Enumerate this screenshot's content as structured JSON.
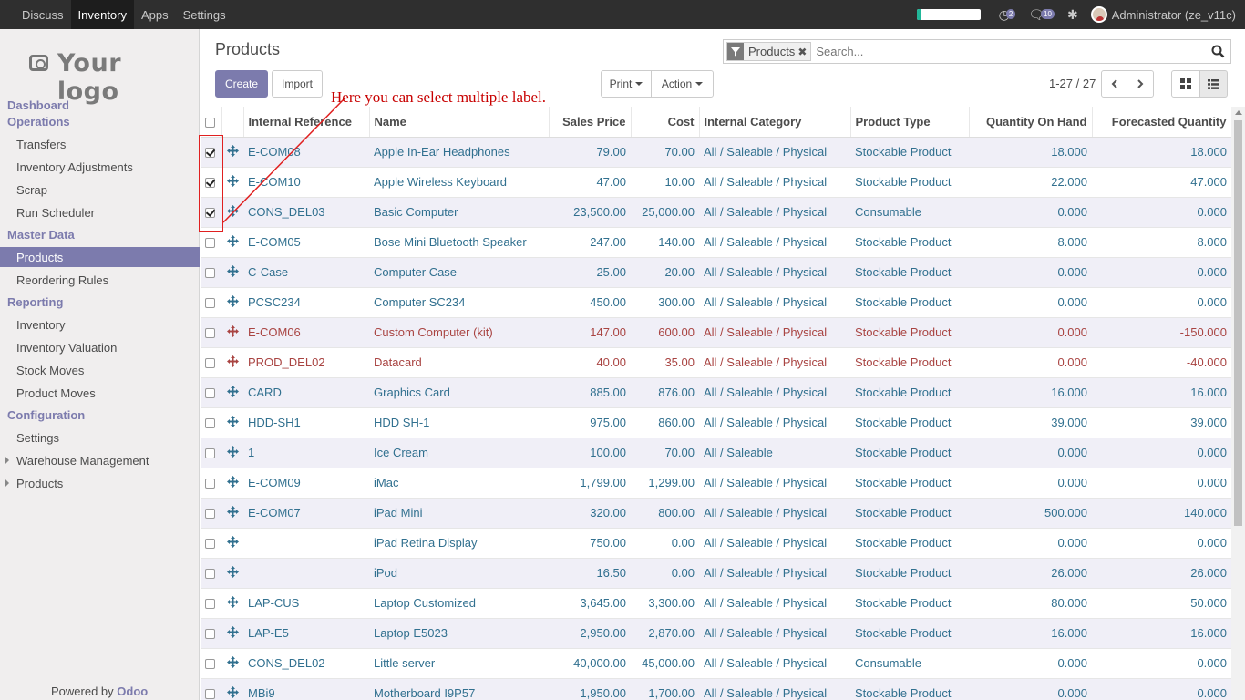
{
  "topbar": {
    "menu": [
      "Discuss",
      "Inventory",
      "Apps",
      "Settings"
    ],
    "active_index": 1,
    "badge_activity": "2",
    "badge_messages": "10",
    "user": "Administrator (ze_v11c)",
    "progress_fraction": 0.07
  },
  "sidebar": {
    "logo_text": "Your logo",
    "sections": [
      {
        "label": "Dashboard"
      },
      {
        "label": "Operations",
        "items": [
          "Transfers",
          "Inventory Adjustments",
          "Scrap",
          "Run Scheduler"
        ]
      },
      {
        "label": "Master Data",
        "items": [
          "Products",
          "Reordering Rules"
        ]
      },
      {
        "label": "Reporting",
        "items": [
          "Inventory",
          "Inventory Valuation",
          "Stock Moves",
          "Product Moves"
        ]
      },
      {
        "label": "Configuration",
        "items": [
          "Settings",
          "Warehouse Management",
          "Products"
        ]
      }
    ],
    "active_item": "Products",
    "powered_by": "Powered by",
    "powered_brand": "Odoo"
  },
  "control": {
    "title": "Products",
    "create": "Create",
    "import": "Import",
    "print": "Print",
    "action": "Action",
    "facet": "Products",
    "search_placeholder": "Search...",
    "pager": "1-27 / 27"
  },
  "annotation": "Here you can select multiple label.",
  "table": {
    "columns": [
      "Internal Reference",
      "Name",
      "Sales Price",
      "Cost",
      "Internal Category",
      "Product Type",
      "Quantity On Hand",
      "Forecasted Quantity"
    ],
    "rows": [
      {
        "checked": true,
        "danger": false,
        "ref": "E-COM08",
        "name": "Apple In-Ear Headphones",
        "price": "79.00",
        "cost": "70.00",
        "cat": "All / Saleable / Physical",
        "type": "Stockable Product",
        "qty": "18.000",
        "fq": "18.000"
      },
      {
        "checked": true,
        "danger": false,
        "ref": "E-COM10",
        "name": "Apple Wireless Keyboard",
        "price": "47.00",
        "cost": "10.00",
        "cat": "All / Saleable / Physical",
        "type": "Stockable Product",
        "qty": "22.000",
        "fq": "47.000"
      },
      {
        "checked": true,
        "danger": false,
        "ref": "CONS_DEL03",
        "name": "Basic Computer",
        "price": "23,500.00",
        "cost": "25,000.00",
        "cat": "All / Saleable / Physical",
        "type": "Consumable",
        "qty": "0.000",
        "fq": "0.000"
      },
      {
        "checked": false,
        "danger": false,
        "ref": "E-COM05",
        "name": "Bose Mini Bluetooth Speaker",
        "price": "247.00",
        "cost": "140.00",
        "cat": "All / Saleable / Physical",
        "type": "Stockable Product",
        "qty": "8.000",
        "fq": "8.000"
      },
      {
        "checked": false,
        "danger": false,
        "ref": "C-Case",
        "name": "Computer Case",
        "price": "25.00",
        "cost": "20.00",
        "cat": "All / Saleable / Physical",
        "type": "Stockable Product",
        "qty": "0.000",
        "fq": "0.000"
      },
      {
        "checked": false,
        "danger": false,
        "ref": "PCSC234",
        "name": "Computer SC234",
        "price": "450.00",
        "cost": "300.00",
        "cat": "All / Saleable / Physical",
        "type": "Stockable Product",
        "qty": "0.000",
        "fq": "0.000"
      },
      {
        "checked": false,
        "danger": true,
        "ref": "E-COM06",
        "name": "Custom Computer (kit)",
        "price": "147.00",
        "cost": "600.00",
        "cat": "All / Saleable / Physical",
        "type": "Stockable Product",
        "qty": "0.000",
        "fq": "-150.000"
      },
      {
        "checked": false,
        "danger": true,
        "ref": "PROD_DEL02",
        "name": "Datacard",
        "price": "40.00",
        "cost": "35.00",
        "cat": "All / Saleable / Physical",
        "type": "Stockable Product",
        "qty": "0.000",
        "fq": "-40.000"
      },
      {
        "checked": false,
        "danger": false,
        "ref": "CARD",
        "name": "Graphics Card",
        "price": "885.00",
        "cost": "876.00",
        "cat": "All / Saleable / Physical",
        "type": "Stockable Product",
        "qty": "16.000",
        "fq": "16.000"
      },
      {
        "checked": false,
        "danger": false,
        "ref": "HDD-SH1",
        "name": "HDD SH-1",
        "price": "975.00",
        "cost": "860.00",
        "cat": "All / Saleable / Physical",
        "type": "Stockable Product",
        "qty": "39.000",
        "fq": "39.000"
      },
      {
        "checked": false,
        "danger": false,
        "ref": "1",
        "name": "Ice Cream",
        "price": "100.00",
        "cost": "70.00",
        "cat": "All / Saleable",
        "type": "Stockable Product",
        "qty": "0.000",
        "fq": "0.000"
      },
      {
        "checked": false,
        "danger": false,
        "ref": "E-COM09",
        "name": "iMac",
        "price": "1,799.00",
        "cost": "1,299.00",
        "cat": "All / Saleable / Physical",
        "type": "Stockable Product",
        "qty": "0.000",
        "fq": "0.000"
      },
      {
        "checked": false,
        "danger": false,
        "ref": "E-COM07",
        "name": "iPad Mini",
        "price": "320.00",
        "cost": "800.00",
        "cat": "All / Saleable / Physical",
        "type": "Stockable Product",
        "qty": "500.000",
        "fq": "140.000"
      },
      {
        "checked": false,
        "danger": false,
        "ref": "",
        "name": "iPad Retina Display",
        "price": "750.00",
        "cost": "0.00",
        "cat": "All / Saleable / Physical",
        "type": "Stockable Product",
        "qty": "0.000",
        "fq": "0.000"
      },
      {
        "checked": false,
        "danger": false,
        "ref": "",
        "name": "iPod",
        "price": "16.50",
        "cost": "0.00",
        "cat": "All / Saleable / Physical",
        "type": "Stockable Product",
        "qty": "26.000",
        "fq": "26.000"
      },
      {
        "checked": false,
        "danger": false,
        "ref": "LAP-CUS",
        "name": "Laptop Customized",
        "price": "3,645.00",
        "cost": "3,300.00",
        "cat": "All / Saleable / Physical",
        "type": "Stockable Product",
        "qty": "80.000",
        "fq": "50.000"
      },
      {
        "checked": false,
        "danger": false,
        "ref": "LAP-E5",
        "name": "Laptop E5023",
        "price": "2,950.00",
        "cost": "2,870.00",
        "cat": "All / Saleable / Physical",
        "type": "Stockable Product",
        "qty": "16.000",
        "fq": "16.000"
      },
      {
        "checked": false,
        "danger": false,
        "ref": "CONS_DEL02",
        "name": "Little server",
        "price": "40,000.00",
        "cost": "45,000.00",
        "cat": "All / Saleable / Physical",
        "type": "Consumable",
        "qty": "0.000",
        "fq": "0.000"
      },
      {
        "checked": false,
        "danger": false,
        "ref": "MBi9",
        "name": "Motherboard I9P57",
        "price": "1,950.00",
        "cost": "1,700.00",
        "cat": "All / Saleable / Physical",
        "type": "Stockable Product",
        "qty": "0.000",
        "fq": "0.000"
      }
    ]
  },
  "colors": {
    "brand": "#7c7bad",
    "link": "#31708f",
    "danger": "#a94442",
    "annotation": "#c80000"
  }
}
